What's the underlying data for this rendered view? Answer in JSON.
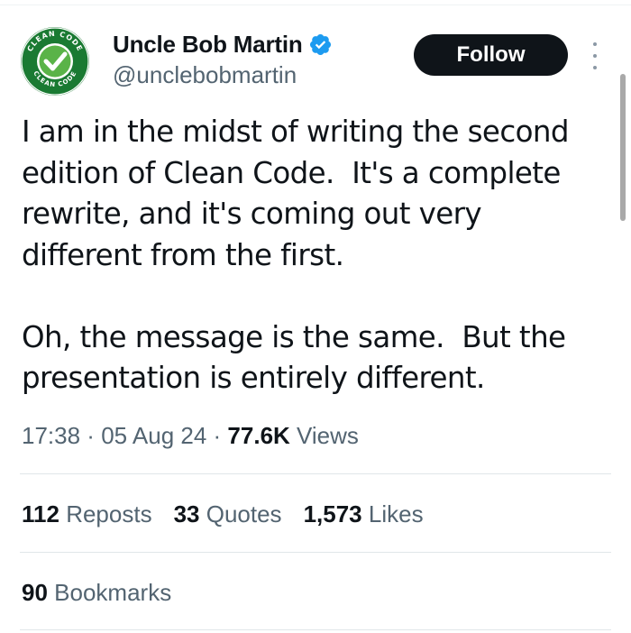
{
  "author": {
    "display_name": "Uncle Bob Martin",
    "handle": "@unclebobmartin",
    "avatar_text_top": "CLEAN CODE",
    "avatar_text_bottom": "CLEAN CODE",
    "verified_color": "#1d9bf0"
  },
  "follow_label": "Follow",
  "tweet": {
    "text": "I am in the midst of writing the second\nedition of Clean Code.  It's a complete\nrewrite, and it's coming out very\ndifferent from the first.\n\nOh, the message is the same.  But the\npresentation is entirely different."
  },
  "meta": {
    "time": "17:38",
    "sep1": " · ",
    "date": "05 Aug 24",
    "sep2": " · ",
    "views_count": "77.6K",
    "views_label": " Views"
  },
  "stats": [
    {
      "count": "112",
      "label": "Reposts"
    },
    {
      "count": "33",
      "label": "Quotes"
    },
    {
      "count": "1,573",
      "label": "Likes"
    }
  ],
  "bookmarks": {
    "count": "90",
    "label": "Bookmarks"
  },
  "colors": {
    "secondary_text": "#536471",
    "primary_text": "#0f1419",
    "avatar_green": "#1f8a3a"
  }
}
